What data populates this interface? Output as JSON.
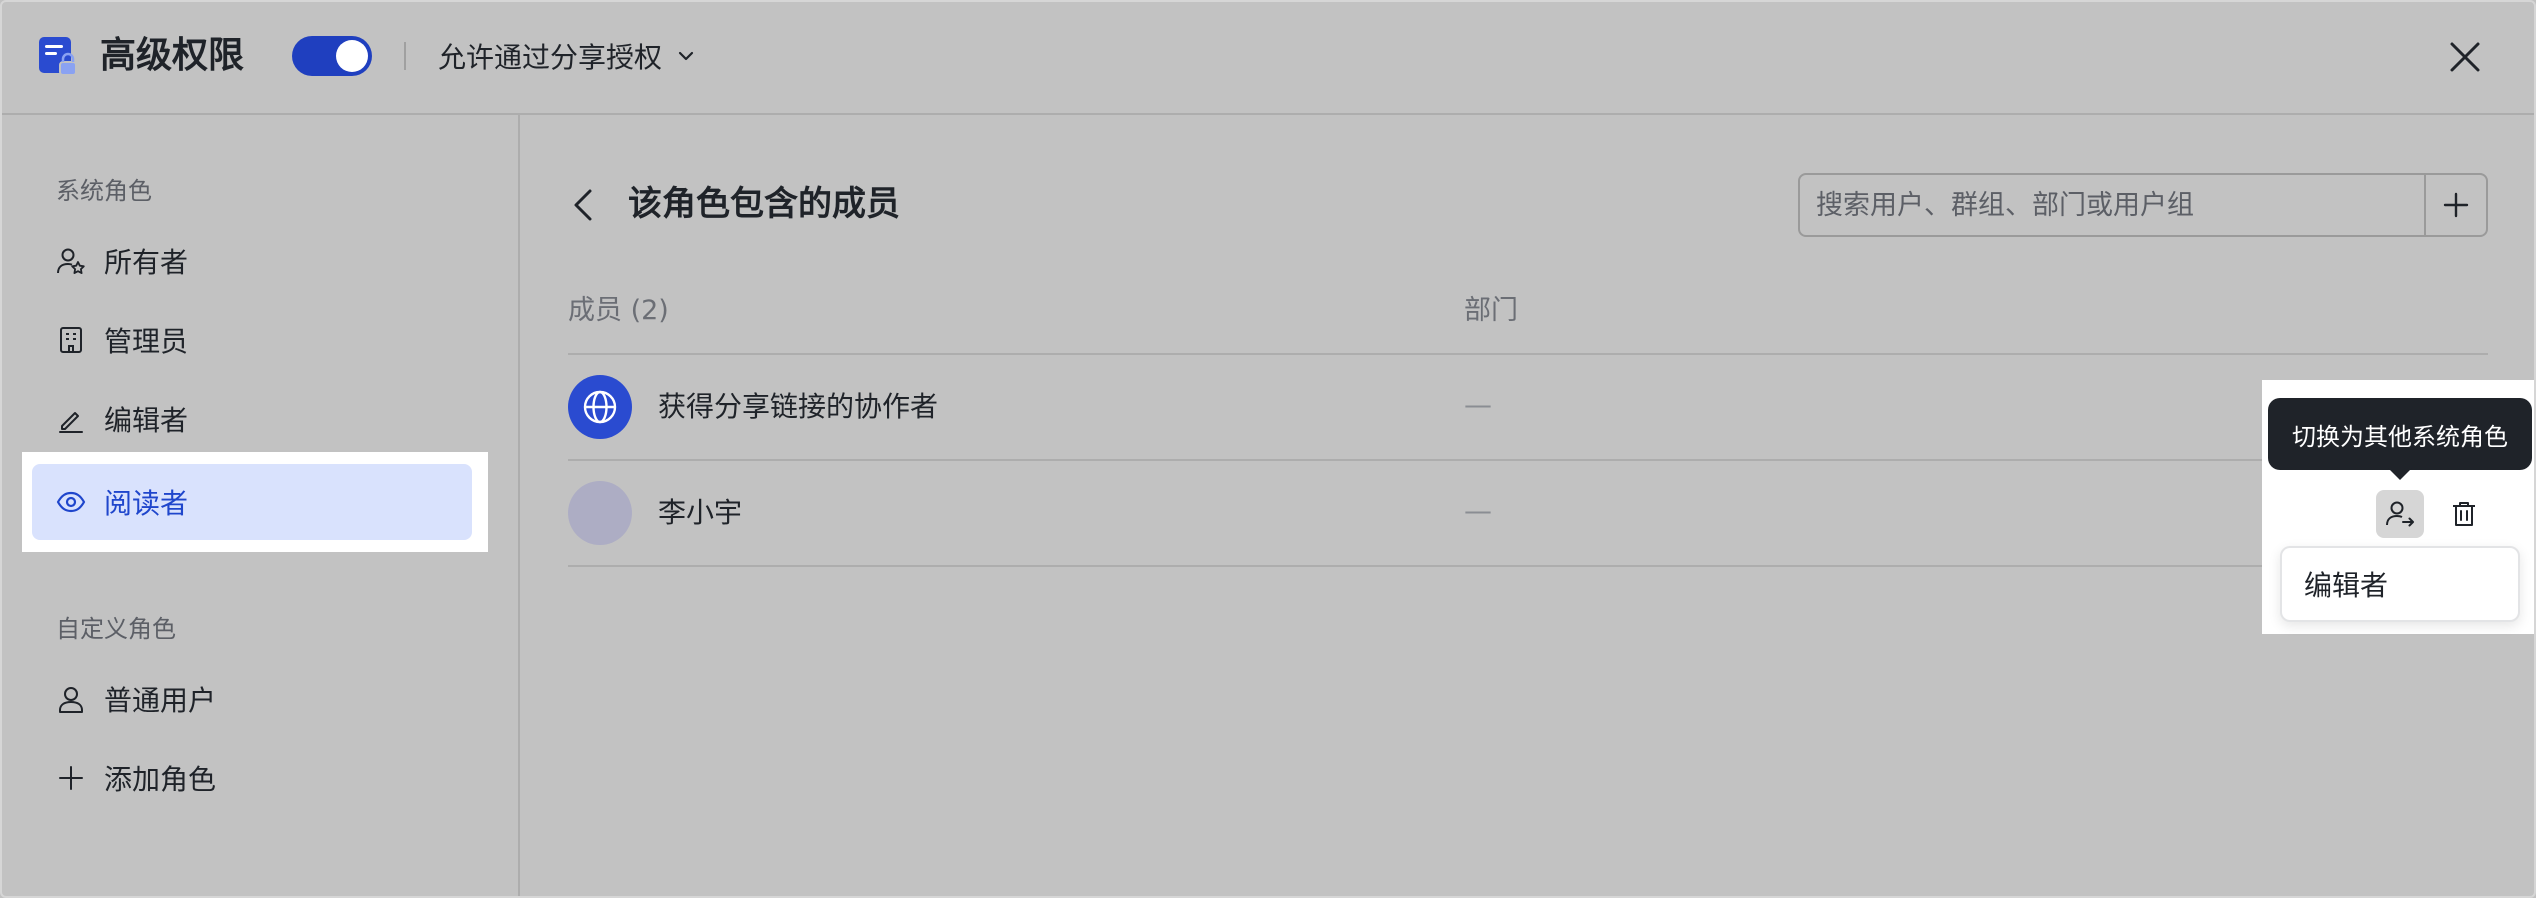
{
  "header": {
    "title": "高级权限",
    "toggle_on": true,
    "share_option": "允许通过分享授权"
  },
  "sidebar": {
    "system_section_label": "系统角色",
    "system_items": [
      {
        "label": "所有者",
        "icon": "user-star-icon"
      },
      {
        "label": "管理员",
        "icon": "building-icon"
      },
      {
        "label": "编辑者",
        "icon": "pencil-icon"
      },
      {
        "label": "阅读者",
        "icon": "eye-icon",
        "active": true
      }
    ],
    "custom_section_label": "自定义角色",
    "custom_items": [
      {
        "label": "普通用户",
        "icon": "user-icon"
      },
      {
        "label": "添加角色",
        "icon": "plus-icon"
      }
    ]
  },
  "main": {
    "title": "该角色包含的成员",
    "search_placeholder": "搜索用户、群组、部门或用户组",
    "columns": {
      "member": "成员 (2)",
      "department": "部门"
    },
    "rows": [
      {
        "name": "获得分享链接的协作者",
        "department": "—",
        "avatar": "globe-icon"
      },
      {
        "name": "李小宇",
        "department": "—",
        "avatar": "avatar-placeholder"
      }
    ]
  },
  "actions": {
    "tooltip": "切换为其他系统角色",
    "dropdown_option": "编辑者"
  },
  "colors": {
    "accent": "#1f3fbf",
    "active_bg": "#d9e2fd",
    "overlay": "#c2c2c2"
  }
}
